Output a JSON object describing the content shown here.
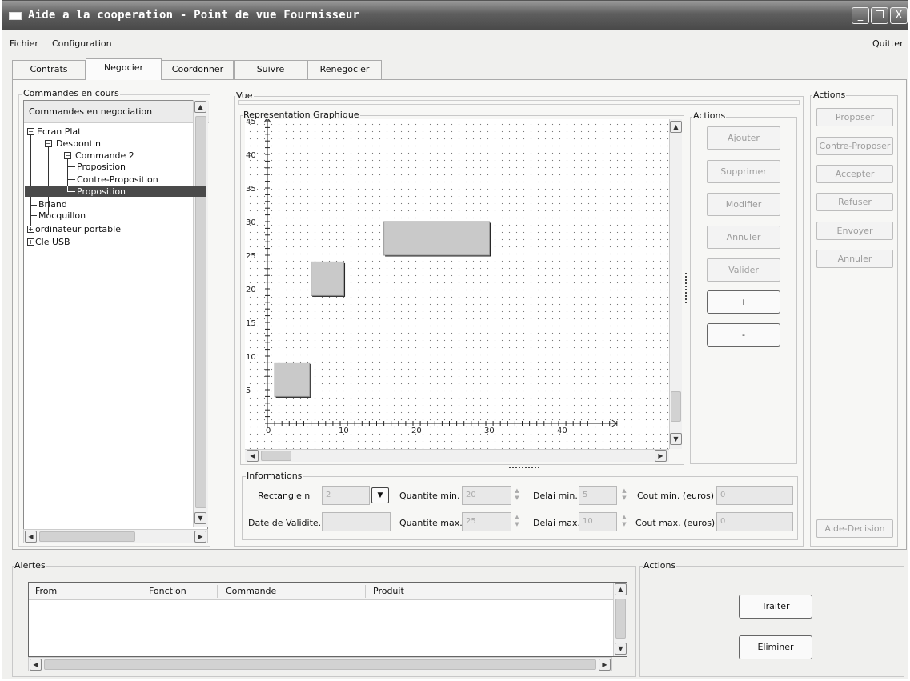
{
  "window": {
    "title": "Aide a la cooperation - Point de vue Fournisseur",
    "controls": [
      "_",
      "❐",
      "X"
    ]
  },
  "menu": {
    "fichier": "Fichier",
    "configuration": "Configuration",
    "quitter": "Quitter"
  },
  "tabs": [
    "Contrats",
    "Negocier",
    "Coordonner",
    "Suivre",
    "Renegocier"
  ],
  "active_tab": "Negocier",
  "left": {
    "group_label": "Commandes en cours",
    "list_header": "Commandes en negociation",
    "tree": {
      "ecran_plat": "Ecran Plat",
      "despontin": "Despontin",
      "commande2": "Commande 2",
      "proposition1": "Proposition",
      "contre_proposition": "Contre-Proposition",
      "proposition2": "Proposition",
      "briand": "Briand",
      "mocquillon": "Mocquillon",
      "ordinateur": "ordinateur portable",
      "cle_usb": "Cle USB"
    },
    "selected_item": "Proposition"
  },
  "vue": {
    "label": "Vue",
    "graph_label": "Representation Graphique",
    "actions_label": "Actions",
    "buttons": {
      "ajouter": "Ajouter",
      "supprimer": "Supprimer",
      "modifier": "Modifier",
      "annuler": "Annuler",
      "valider": "Valider",
      "plus": "+",
      "minus": "-"
    }
  },
  "chart_data": {
    "type": "scatter",
    "x_ticks": [
      "0",
      "10",
      "20",
      "30",
      "40"
    ],
    "y_ticks": [
      "5",
      "10",
      "15",
      "20",
      "25",
      "30",
      "35",
      "40",
      "45"
    ],
    "xlim": [
      0,
      48
    ],
    "ylim": [
      0,
      45
    ],
    "rectangles": [
      {
        "x0": 1,
        "x1": 5.8,
        "y0": 4,
        "y1": 9
      },
      {
        "x0": 6,
        "x1": 10.5,
        "y0": 19,
        "y1": 24
      },
      {
        "x0": 16,
        "x1": 30.5,
        "y0": 25,
        "y1": 30
      }
    ]
  },
  "informations": {
    "label": "Informations",
    "rectangle_label": "Rectangle n",
    "rectangle_value": "2",
    "date_label": "Date de Validite.",
    "date_value": "",
    "qmin_label": "Quantite min.",
    "qmin_value": "20",
    "qmax_label": "Quantite max.",
    "qmax_value": "25",
    "dmin_label": "Delai min.",
    "dmin_value": "5",
    "dmax_label": "Delai max.",
    "dmax_value": "10",
    "cmin_label": "Cout min. (euros)",
    "cmin_value": "0",
    "cmax_label": "Cout max. (euros)",
    "cmax_value": "0"
  },
  "right_actions": {
    "label": "Actions",
    "buttons": {
      "proposer": "Proposer",
      "contre_proposer": "Contre-Proposer",
      "accepter": "Accepter",
      "refuser": "Refuser",
      "envoyer": "Envoyer",
      "annuler": "Annuler",
      "aide_decision": "Aide-Decision"
    }
  },
  "alertes": {
    "label": "Alertes",
    "columns": [
      "From",
      "Fonction",
      "Commande",
      "Produit"
    ]
  },
  "bottom_actions": {
    "label": "Actions",
    "traiter": "Traiter",
    "eliminer": "Eliminer"
  }
}
